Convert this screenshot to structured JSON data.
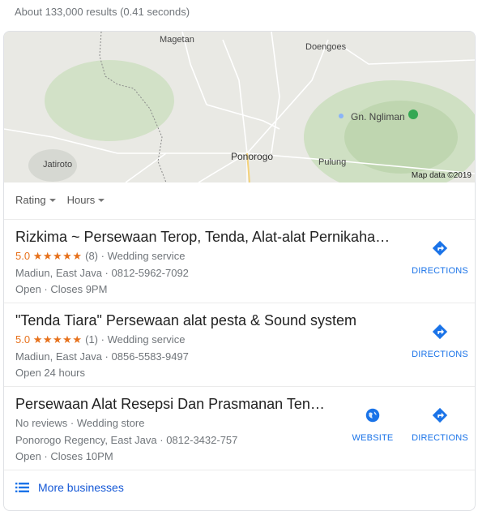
{
  "stats": "About 133,000 results (0.41 seconds)",
  "map": {
    "labels": [
      "Magetan",
      "Doengoes",
      "Gn. Ngliman",
      "Jatiroto",
      "Ponorogo",
      "Pulung"
    ],
    "credit": "Map data ©2019"
  },
  "filters": [
    "Rating",
    "Hours"
  ],
  "listings": [
    {
      "title": "Rizkima ~ Persewaan Terop, Tenda, Alat-alat Pernikaha…",
      "rating": "5.0",
      "stars": "★★★★★",
      "reviews": "(8)",
      "category": "· Wedding service",
      "address": "Madiun, East Java · 0812-5962-7092",
      "hours": "Open · Closes 9PM",
      "directions": "DIRECTIONS"
    },
    {
      "title": "\"Tenda Tiara\" Persewaan alat pesta & Sound system",
      "rating": "5.0",
      "stars": "★★★★★",
      "reviews": "(1)",
      "category": "· Wedding service",
      "address": "Madiun, East Java · 0856-5583-9497",
      "hours": "Open 24 hours",
      "directions": "DIRECTIONS"
    },
    {
      "title": "Persewaan Alat Resepsi Dan Prasmanan Ten…",
      "reviews_text": "No reviews · Wedding store",
      "address": "Ponorogo Regency, East Java · 0812-3432-757",
      "hours": "Open · Closes 10PM",
      "website": "WEBSITE",
      "directions": "DIRECTIONS"
    }
  ],
  "more": "More businesses",
  "icons": {
    "directions": "directions-icon",
    "website": "globe-icon",
    "list": "list-icon",
    "pin": "map-pin-icon"
  },
  "colors": {
    "link": "#1a73e8",
    "rating": "#e7711b",
    "pin_green": "#34a853"
  }
}
